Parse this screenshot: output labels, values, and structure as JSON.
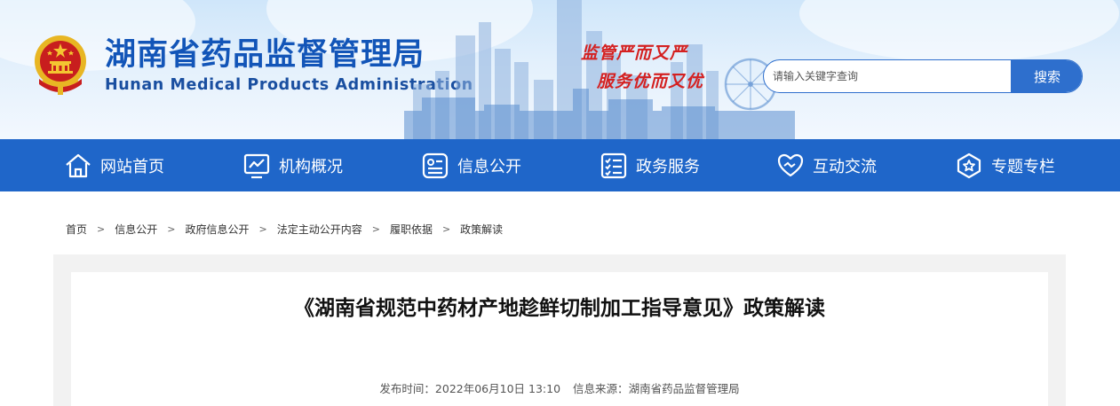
{
  "header": {
    "title": "湖南省药品监督管理局",
    "subtitle": "Hunan Medical Products Administration",
    "slogan_line1": "监管严而又严",
    "slogan_line2": "服务优而又优",
    "emblem": "national-emblem"
  },
  "search": {
    "placeholder": "请输入关键字查询",
    "value": "",
    "button_label": "搜索",
    "accent_color": "#2e6fcd"
  },
  "nav": {
    "background_color": "#1f66c9",
    "items": [
      {
        "label": "网站首页",
        "icon": "home-icon"
      },
      {
        "label": "机构概况",
        "icon": "monitor-chart-icon"
      },
      {
        "label": "信息公开",
        "icon": "info-card-icon"
      },
      {
        "label": "政务服务",
        "icon": "checklist-icon"
      },
      {
        "label": "互动交流",
        "icon": "handshake-heart-icon"
      },
      {
        "label": "专题专栏",
        "icon": "star-badge-icon"
      }
    ]
  },
  "breadcrumb": [
    "首页",
    "信息公开",
    "政府信息公开",
    "法定主动公开内容",
    "履职依据",
    "政策解读"
  ],
  "article": {
    "title": "《湖南省规范中药材产地趁鲜切制加工指导意见》政策解读",
    "publish_label": "发布时间：",
    "publish_time": "2022年06月10日 13:10",
    "source_label": "信息来源：",
    "source": "湖南省药品监督管理局"
  }
}
